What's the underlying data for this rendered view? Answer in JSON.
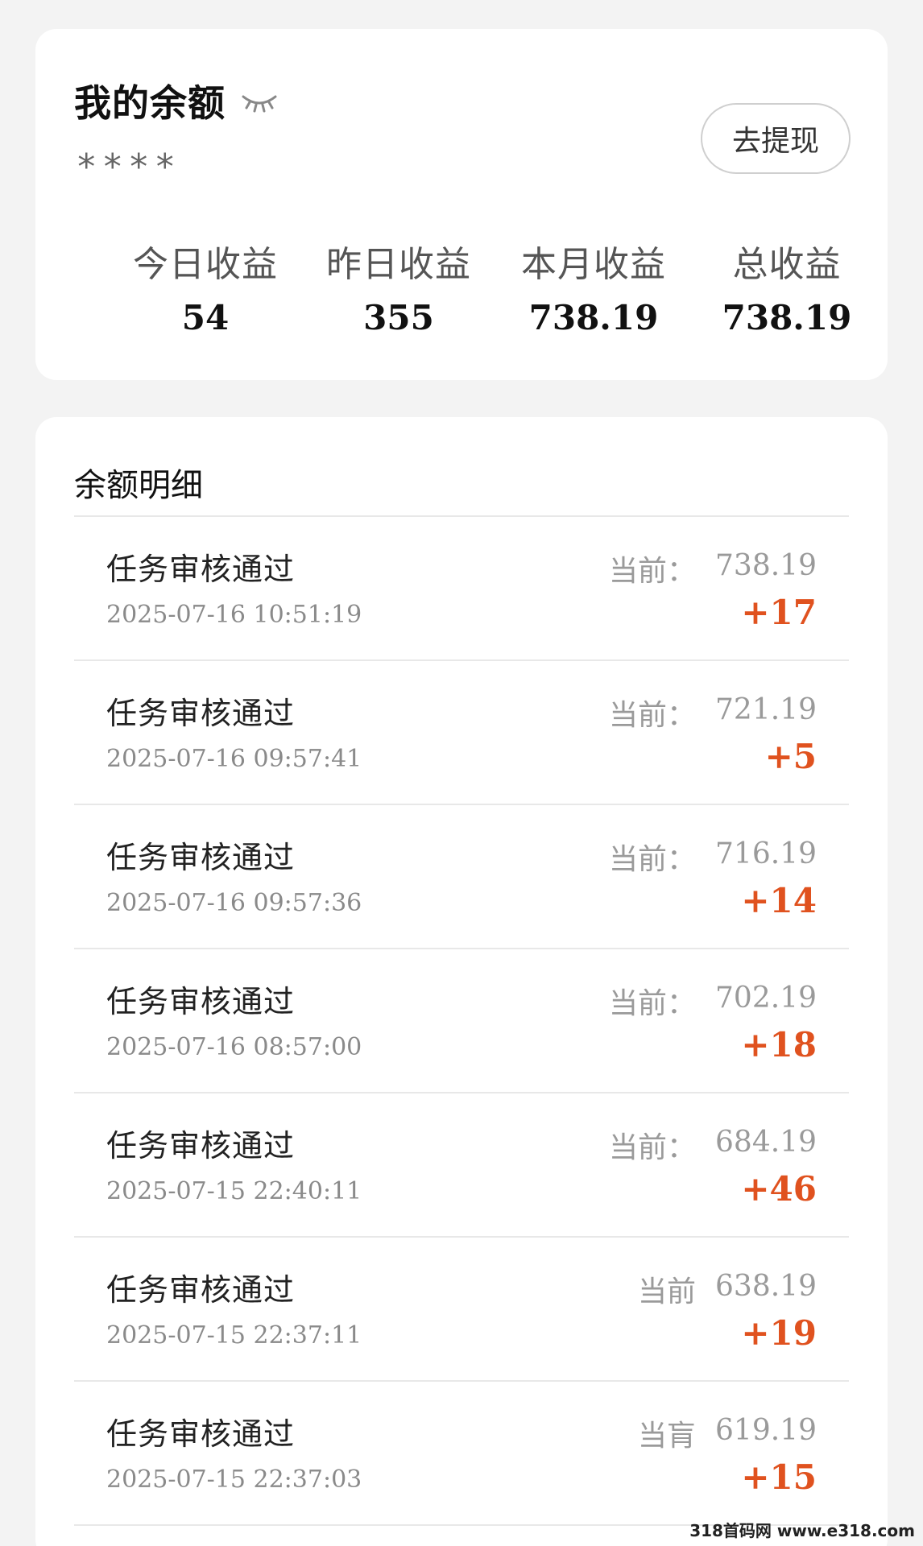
{
  "balance_card": {
    "title": "我的余额",
    "hidden_amount": "****",
    "withdraw_label": "去提现",
    "stats": [
      {
        "label": "今日收益",
        "value": "54"
      },
      {
        "label": "昨日收益",
        "value": "355"
      },
      {
        "label": "本月收益",
        "value": "738.19"
      },
      {
        "label": "总收益",
        "value": "738.19"
      }
    ]
  },
  "detail_card": {
    "title": "余额明细",
    "rows": [
      {
        "title": "任务审核通过",
        "time": "2025-07-16 10:51:19",
        "current_label": "当前：",
        "current_value": "738.19",
        "delta": "+17"
      },
      {
        "title": "任务审核通过",
        "time": "2025-07-16 09:57:41",
        "current_label": "当前：",
        "current_value": "721.19",
        "delta": "+5"
      },
      {
        "title": "任务审核通过",
        "time": "2025-07-16 09:57:36",
        "current_label": "当前：",
        "current_value": "716.19",
        "delta": "+14"
      },
      {
        "title": "任务审核通过",
        "time": "2025-07-16 08:57:00",
        "current_label": "当前：",
        "current_value": "702.19",
        "delta": "+18"
      },
      {
        "title": "任务审核通过",
        "time": "2025-07-15 22:40:11",
        "current_label": "当前：",
        "current_value": "684.19",
        "delta": "+46"
      },
      {
        "title": "任务审核通过",
        "time": "2025-07-15 22:37:11",
        "current_label": "当前",
        "current_value": "638.19",
        "delta": "+19"
      },
      {
        "title": "任务审核通过",
        "time": "2025-07-15 22:37:03",
        "current_label": "当肓",
        "current_value": "619.19",
        "delta": "+15"
      }
    ]
  },
  "watermark": "318首码网 www.e318.com",
  "colors": {
    "delta": "#e0521f",
    "muted": "#9a9a9a",
    "background": "#f3f3f3"
  },
  "icons": {
    "visibility": "eye-closed-icon"
  }
}
